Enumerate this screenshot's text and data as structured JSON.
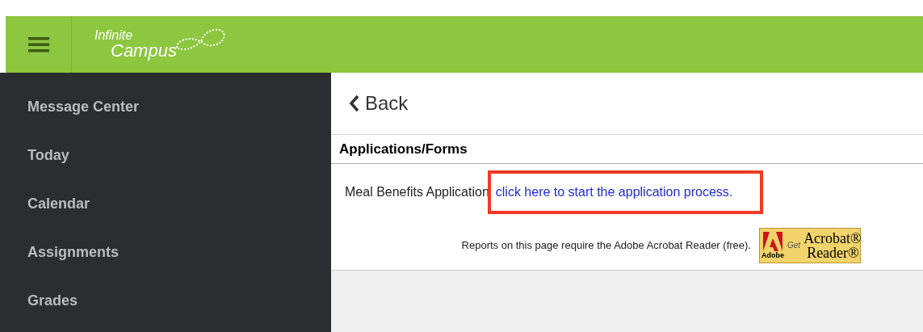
{
  "header": {
    "logo": {
      "line_1": "Infinite",
      "line_2": "Campus"
    }
  },
  "sidebar": {
    "items": [
      {
        "label": "Message Center"
      },
      {
        "label": "Today"
      },
      {
        "label": "Calendar"
      },
      {
        "label": "Assignments"
      },
      {
        "label": "Grades"
      }
    ]
  },
  "content": {
    "back": "Back",
    "section_title": "Applications/Forms",
    "application": {
      "label": "Meal Benefits Application",
      "link": "click here to start the application process.",
      "highlighted": true
    },
    "note": "Reports on this page require the Adobe Acrobat Reader (free).",
    "badge": {
      "brand": "Adobe",
      "get": "Get",
      "line_1": "Acrobat®",
      "line_2": "Reader®"
    }
  }
}
